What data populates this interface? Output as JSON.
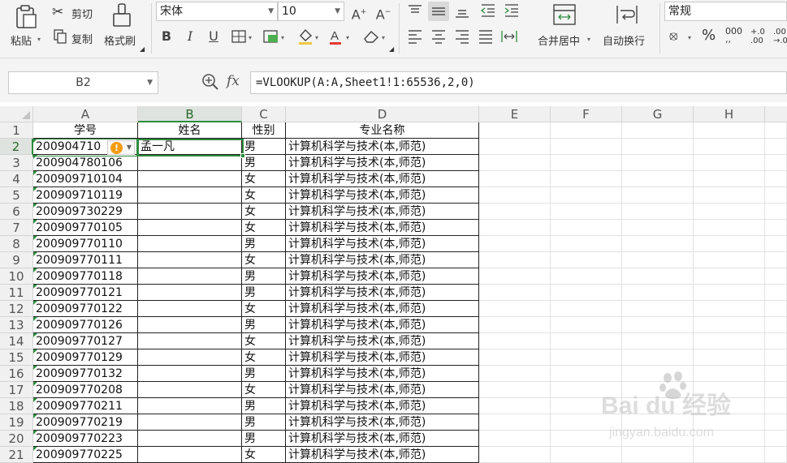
{
  "ribbon": {
    "paste": "粘贴",
    "cut": "剪切",
    "copy": "复制",
    "format_painter": "格式刷",
    "font_name": "宋体",
    "font_size": "10",
    "bold": "B",
    "italic": "I",
    "underline": "U",
    "merge_center": "合并居中",
    "auto_wrap": "自动换行",
    "number_format": "常规"
  },
  "formula_bar": {
    "cell_ref": "B2",
    "fx": "fx",
    "formula": "=VLOOKUP(A:A,Sheet1!1:65536,2,0)"
  },
  "sheet": {
    "columns": [
      "A",
      "B",
      "C",
      "D",
      "E",
      "F",
      "G",
      "H"
    ],
    "headers": [
      "学号",
      "姓名",
      "性别",
      "专业名称"
    ],
    "rows": [
      {
        "num": "2",
        "id": "200904710",
        "name": "孟一凡",
        "gender": "男",
        "major": "计算机科学与技术(本,师范)"
      },
      {
        "num": "3",
        "id": "200904780106",
        "name": "",
        "gender": "男",
        "major": "计算机科学与技术(本,师范)"
      },
      {
        "num": "4",
        "id": "200909710104",
        "name": "",
        "gender": "女",
        "major": "计算机科学与技术(本,师范)"
      },
      {
        "num": "5",
        "id": "200909710119",
        "name": "",
        "gender": "女",
        "major": "计算机科学与技术(本,师范)"
      },
      {
        "num": "6",
        "id": "200909730229",
        "name": "",
        "gender": "女",
        "major": "计算机科学与技术(本,师范)"
      },
      {
        "num": "7",
        "id": "200909770105",
        "name": "",
        "gender": "女",
        "major": "计算机科学与技术(本,师范)"
      },
      {
        "num": "8",
        "id": "200909770110",
        "name": "",
        "gender": "男",
        "major": "计算机科学与技术(本,师范)"
      },
      {
        "num": "9",
        "id": "200909770111",
        "name": "",
        "gender": "女",
        "major": "计算机科学与技术(本,师范)"
      },
      {
        "num": "10",
        "id": "200909770118",
        "name": "",
        "gender": "男",
        "major": "计算机科学与技术(本,师范)"
      },
      {
        "num": "11",
        "id": "200909770121",
        "name": "",
        "gender": "男",
        "major": "计算机科学与技术(本,师范)"
      },
      {
        "num": "12",
        "id": "200909770122",
        "name": "",
        "gender": "女",
        "major": "计算机科学与技术(本,师范)"
      },
      {
        "num": "13",
        "id": "200909770126",
        "name": "",
        "gender": "男",
        "major": "计算机科学与技术(本,师范)"
      },
      {
        "num": "14",
        "id": "200909770127",
        "name": "",
        "gender": "女",
        "major": "计算机科学与技术(本,师范)"
      },
      {
        "num": "15",
        "id": "200909770129",
        "name": "",
        "gender": "女",
        "major": "计算机科学与技术(本,师范)"
      },
      {
        "num": "16",
        "id": "200909770132",
        "name": "",
        "gender": "男",
        "major": "计算机科学与技术(本,师范)"
      },
      {
        "num": "17",
        "id": "200909770208",
        "name": "",
        "gender": "女",
        "major": "计算机科学与技术(本,师范)"
      },
      {
        "num": "18",
        "id": "200909770211",
        "name": "",
        "gender": "男",
        "major": "计算机科学与技术(本,师范)"
      },
      {
        "num": "19",
        "id": "200909770219",
        "name": "",
        "gender": "男",
        "major": "计算机科学与技术(本,师范)"
      },
      {
        "num": "20",
        "id": "200909770223",
        "name": "",
        "gender": "男",
        "major": "计算机科学与技术(本,师范)"
      },
      {
        "num": "21",
        "id": "200909770225",
        "name": "",
        "gender": "女",
        "major": "计算机科学与技术(本,师范)"
      }
    ]
  },
  "watermark": {
    "brand": "Bai du 经验",
    "url": "jingyan.baidu.com"
  },
  "colors": {
    "selection": "#2e8b3e",
    "warning": "#f39c12",
    "ribbon_bg": "#f4f4f4"
  }
}
